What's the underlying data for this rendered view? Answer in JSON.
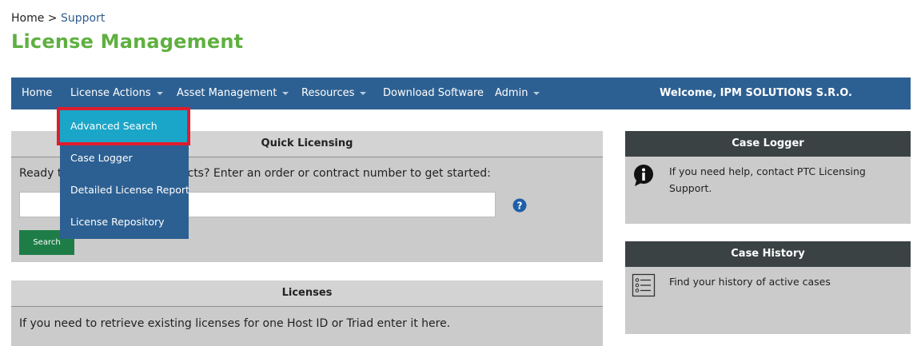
{
  "breadcrumb": {
    "home": "Home",
    "separator": ">",
    "current": "Support"
  },
  "page_title": "License Management",
  "nav": {
    "items": [
      {
        "label": "Home"
      },
      {
        "label": "License Actions"
      },
      {
        "label": "Asset Management"
      },
      {
        "label": "Resources"
      },
      {
        "label": "Download Software"
      },
      {
        "label": "Admin"
      }
    ],
    "welcome": "Welcome, IPM SOLUTIONS S.R.O."
  },
  "dropdown": {
    "items": [
      {
        "label": "Advanced Search"
      },
      {
        "label": "Case Logger"
      },
      {
        "label": "Detailed License Report"
      },
      {
        "label": "License Repository"
      }
    ]
  },
  "quick_licensing": {
    "title": "Quick Licensing",
    "prompt": "Ready to start licensing products? Enter an order or contract number to get started:",
    "input_value": "",
    "search_label": "Search"
  },
  "licenses": {
    "title": "Licenses",
    "text": "If you need to retrieve existing licenses for one Host ID or Triad enter it here."
  },
  "case_logger": {
    "title": "Case Logger",
    "text": "If you need help, contact PTC Licensing Support.",
    "icon": "info-speech-icon"
  },
  "case_history": {
    "title": "Case History",
    "text": "Find your history of active cases",
    "icon": "list-icon"
  },
  "colors": {
    "nav_bg": "#2d6092",
    "title_green": "#5fb040",
    "highlight_red": "#e01c2c",
    "active_item": "#1aa6c8",
    "search_button": "#1e7d47",
    "panel_header_dark": "#3a4244"
  }
}
